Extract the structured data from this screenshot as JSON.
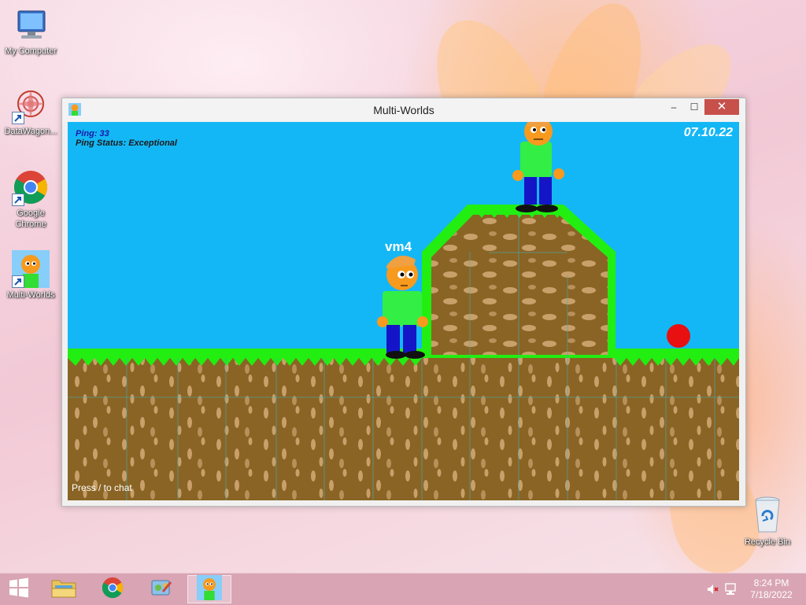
{
  "desktop": {
    "icons": [
      {
        "label": "My Computer",
        "icon": "computer-icon"
      },
      {
        "label": "DataWagon...",
        "icon": "datawagon-icon"
      },
      {
        "label": "Google Chrome",
        "icon": "chrome-icon"
      },
      {
        "label": "Multi-Worlds",
        "icon": "multi-worlds-icon"
      },
      {
        "label": "Recycle Bin",
        "icon": "recycle-bin-icon"
      }
    ]
  },
  "window": {
    "title": "Multi-Worlds",
    "buttons": {
      "minimize": "‒",
      "maximize": "☐",
      "close": "✕"
    }
  },
  "game": {
    "ping_text": "Ping: 33",
    "ping_status_text": "Ping Status: Exceptional",
    "date": "07.10.22",
    "player_name": "vm4",
    "chat_hint": "Press / to chat",
    "colors": {
      "sky": "#14b7f5",
      "grass": "#22ee11",
      "dirt": "#8a6424",
      "dirt_spot": "#c9a06a",
      "ball": "#e81010"
    }
  },
  "taskbar": {
    "items": [
      {
        "name": "start-button",
        "icon": "windows-logo-icon"
      },
      {
        "name": "file-explorer",
        "icon": "folder-icon"
      },
      {
        "name": "chrome",
        "icon": "chrome-icon"
      },
      {
        "name": "control-panel",
        "icon": "control-panel-icon"
      },
      {
        "name": "multi-worlds",
        "icon": "multi-worlds-icon",
        "active": true
      }
    ],
    "time": "8:24 PM",
    "date": "7/18/2022"
  }
}
